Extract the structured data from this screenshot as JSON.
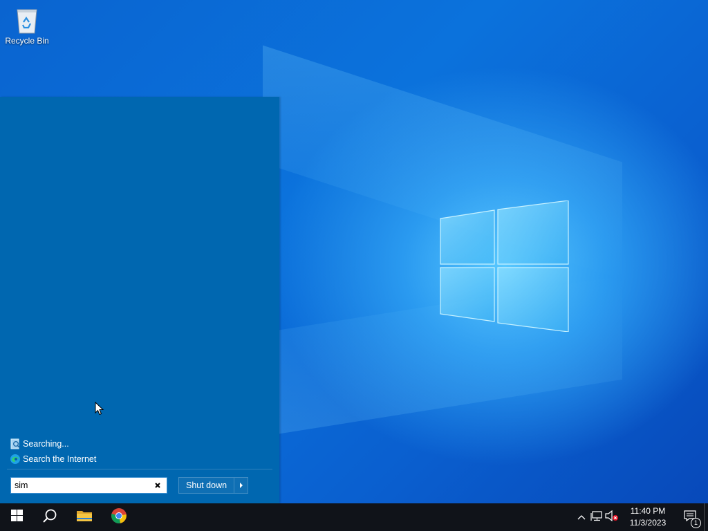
{
  "desktop": {
    "icons": [
      {
        "label": "Recycle Bin",
        "icon": "recycle-bin-icon"
      }
    ]
  },
  "start_menu": {
    "results": [
      {
        "label": "Searching...",
        "icon": "searching-icon"
      },
      {
        "label": "Search the Internet",
        "icon": "edge-icon"
      }
    ],
    "search_value": "sim",
    "shutdown_label": "Shut down"
  },
  "taskbar": {
    "pinned": [
      {
        "name": "start-button",
        "icon": "windows-icon"
      },
      {
        "name": "search-button",
        "icon": "search-icon"
      },
      {
        "name": "file-explorer-button",
        "icon": "folder-icon"
      },
      {
        "name": "chrome-button",
        "icon": "chrome-icon"
      }
    ],
    "clock": {
      "time": "11:40 PM",
      "date": "11/3/2023"
    },
    "notification_count": "1"
  },
  "colors": {
    "start_menu_bg": "#0067b0",
    "taskbar_bg": "#101319",
    "folder_yellow": "#f5c542"
  }
}
